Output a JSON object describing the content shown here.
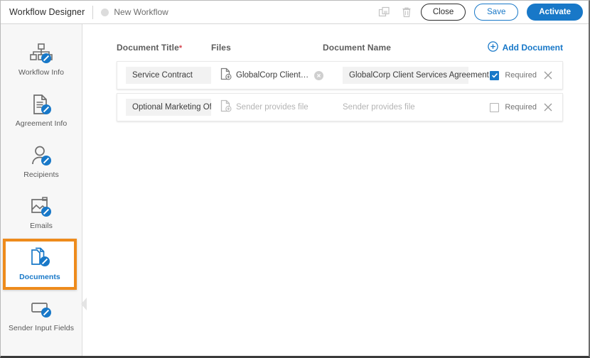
{
  "topbar": {
    "app_title": "Workflow Designer",
    "workflow_name": "New Workflow",
    "status_dot_color": "#dcdcdc",
    "icons": {
      "duplicate": "duplicate-icon",
      "trash": "trash-icon"
    },
    "buttons": {
      "close": "Close",
      "save": "Save",
      "activate": "Activate"
    },
    "colors": {
      "accent_blue": "#1878c8",
      "close_border": "#2b2b2b"
    }
  },
  "sidebar": {
    "selected_index": 4,
    "highlight_color": "#ee8b1c",
    "items": [
      {
        "label": "Workflow Info",
        "icon": "sitemap-edit-icon"
      },
      {
        "label": "Agreement Info",
        "icon": "document-edit-icon"
      },
      {
        "label": "Recipients",
        "icon": "person-edit-icon"
      },
      {
        "label": "Emails",
        "icon": "image-edit-icon"
      },
      {
        "label": "Documents",
        "icon": "documents-edit-icon"
      },
      {
        "label": "Sender Input Fields",
        "icon": "field-edit-icon"
      }
    ]
  },
  "main": {
    "columns": {
      "title": "Document Title",
      "title_required_marker": "*",
      "files": "Files",
      "document_name": "Document Name"
    },
    "add_document_label": "Add Document",
    "add_document_icon": "plus-circle-icon",
    "required_label": "Required",
    "rows": [
      {
        "title": "Service Contract",
        "file_name": "GlobalCorp Client Servic...",
        "file_is_placeholder": false,
        "has_clear": true,
        "document_name": "GlobalCorp Client Services Agreement",
        "document_name_is_placeholder": false,
        "required": true
      },
      {
        "title": "Optional Marketing Offer",
        "file_name": "Sender provides file",
        "file_is_placeholder": true,
        "has_clear": false,
        "document_name": "Sender provides file",
        "document_name_is_placeholder": true,
        "required": false
      }
    ]
  }
}
